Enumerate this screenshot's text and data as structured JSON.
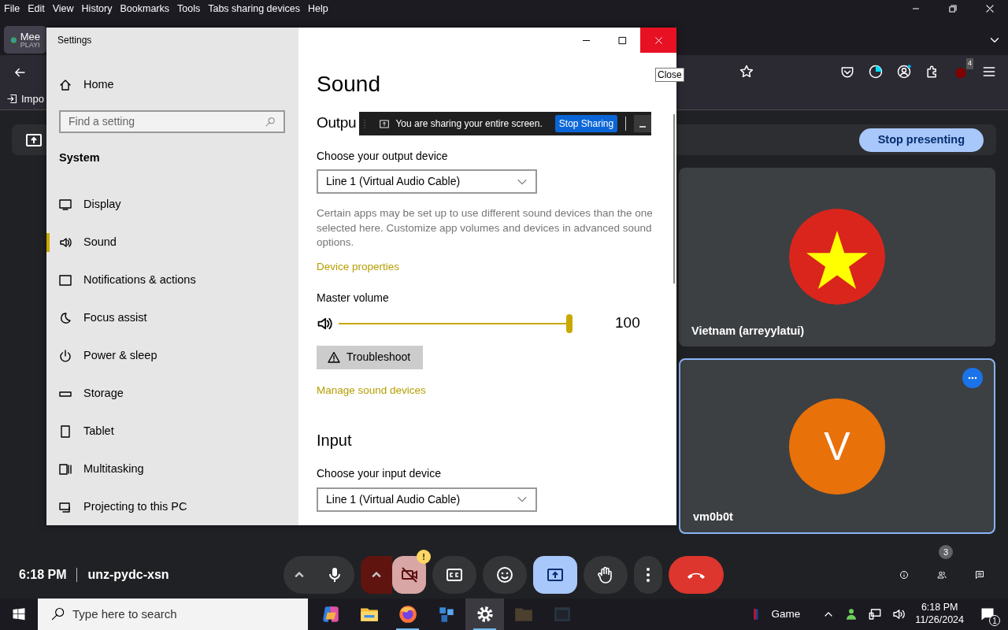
{
  "menu_bar": [
    "File",
    "Edit",
    "View",
    "History",
    "Bookmarks",
    "Tools",
    "Tabs sharing devices",
    "Help"
  ],
  "browser_tab": {
    "title": "Mee",
    "subtitle": "PLAYI"
  },
  "toolbar": {
    "extension_badge": "4"
  },
  "bookmarks": [
    "Impo"
  ],
  "presentation": {
    "stop_button": "Stop presenting"
  },
  "participants": [
    {
      "name": "Vietnam (arreyylatui)",
      "kind": "flag",
      "highlighted": false
    },
    {
      "name": "vm0b0t",
      "kind": "letter",
      "initial": "V",
      "highlighted": true
    }
  ],
  "meeting": {
    "time": "6:18 PM",
    "code": "unz-pydc-xsn"
  },
  "controls": [
    {
      "kind": "caret",
      "off": false,
      "active": false
    },
    {
      "kind": "mic",
      "off": false,
      "active": false
    },
    {
      "kind": "caret",
      "off": true,
      "active": false
    },
    {
      "kind": "camera",
      "off": true,
      "active": false,
      "badge": "!"
    },
    {
      "kind": "captions",
      "off": false,
      "active": false
    },
    {
      "kind": "emoji",
      "off": false,
      "active": false
    },
    {
      "kind": "present",
      "off": false,
      "active": true
    },
    {
      "kind": "hand",
      "off": false,
      "active": false
    },
    {
      "kind": "more",
      "off": false,
      "active": false
    },
    {
      "kind": "hangup",
      "off": false,
      "active": false
    }
  ],
  "side_controls": [
    {
      "kind": "info"
    },
    {
      "kind": "people",
      "badge": "3"
    },
    {
      "kind": "chat"
    }
  ],
  "settings": {
    "title": "Settings",
    "home": "Home",
    "search": {
      "placeholder": "Find a setting"
    },
    "section": "System",
    "nav": [
      {
        "label": "Display",
        "selected": false
      },
      {
        "label": "Sound",
        "selected": true
      },
      {
        "label": "Notifications & actions",
        "selected": false
      },
      {
        "label": "Focus assist",
        "selected": false
      },
      {
        "label": "Power & sleep",
        "selected": false
      },
      {
        "label": "Storage",
        "selected": false
      },
      {
        "label": "Tablet",
        "selected": false
      },
      {
        "label": "Multitasking",
        "selected": false
      },
      {
        "label": "Projecting to this PC",
        "selected": false
      }
    ],
    "page": {
      "title": "Sound",
      "output_heading": "Outpu",
      "output_label": "Choose your output device",
      "output_device": "Line 1 (Virtual Audio Cable)",
      "note": "Certain apps may be set up to use different sound devices than the one selected here. Customize app volumes and devices in advanced sound options.",
      "device_properties": "Device properties",
      "volume_label": "Master volume",
      "volume": {
        "level": 1.0,
        "reading": "100"
      },
      "troubleshoot": "Troubleshoot",
      "manage_link": "Manage sound devices",
      "input_heading": "Input",
      "input_label": "Choose your input device",
      "input_device": "Line 1 (Virtual Audio Cable)"
    }
  },
  "sharing_bar": {
    "message": "You are sharing your entire screen.",
    "stop_button": "Stop Sharing"
  },
  "tooltip": "Close",
  "taskbar": {
    "search_placeholder": "Type here to search",
    "apps": [
      {
        "running": false,
        "active": false,
        "dimmed": false
      },
      {
        "running": false,
        "active": false,
        "dimmed": false
      },
      {
        "running": true,
        "active": false,
        "dimmed": false
      },
      {
        "running": false,
        "active": false,
        "dimmed": false
      },
      {
        "running": true,
        "active": true,
        "dimmed": false
      },
      {
        "running": false,
        "active": false,
        "dimmed": true
      },
      {
        "running": false,
        "active": false,
        "dimmed": true
      }
    ],
    "news": "Game",
    "time": "6:18 PM",
    "date": "11/26/2024",
    "notifications": "1"
  }
}
